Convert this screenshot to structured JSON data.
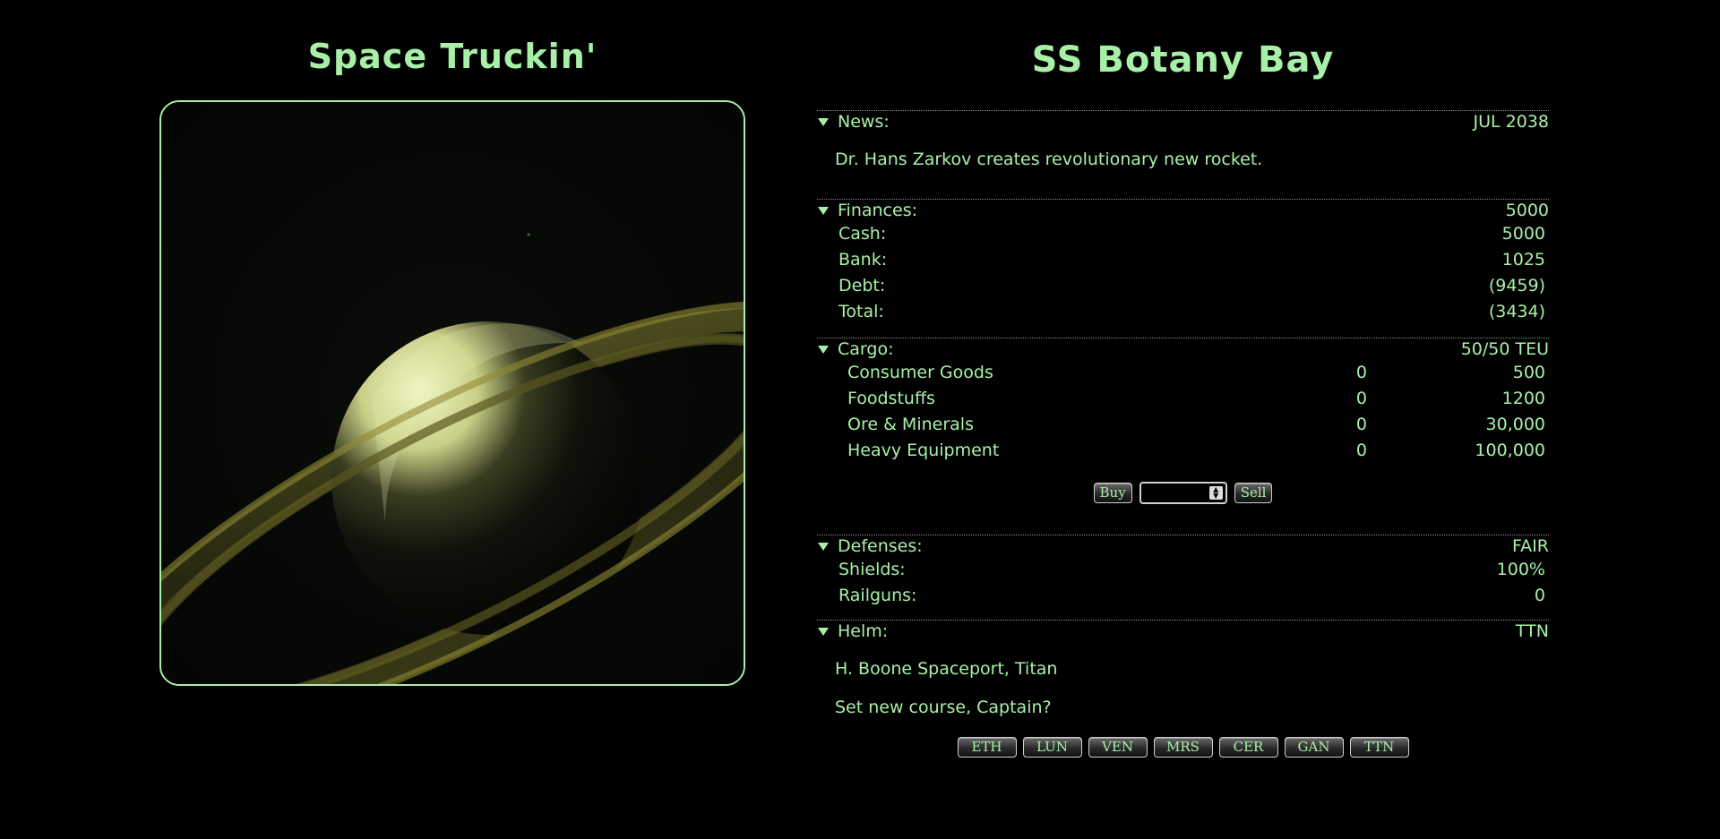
{
  "app": {
    "title": "Space Truckin'"
  },
  "ship": {
    "name": "SS Botany Bay"
  },
  "news": {
    "label": "News:",
    "date": "JUL 2038",
    "headline": "Dr. Hans Zarkov creates revolutionary new rocket."
  },
  "finances": {
    "label": "Finances:",
    "summary": "5000",
    "rows": [
      {
        "label": "Cash:",
        "value": "5000"
      },
      {
        "label": "Bank:",
        "value": "1025"
      },
      {
        "label": "Debt:",
        "value": "(9459)"
      },
      {
        "label": "Total:",
        "value": "(3434)"
      }
    ]
  },
  "cargo": {
    "label": "Cargo:",
    "capacity": "50/50 TEU",
    "items": [
      {
        "name": "Consumer Goods",
        "qty": "0",
        "price": "500"
      },
      {
        "name": "Foodstuffs",
        "qty": "0",
        "price": "1200"
      },
      {
        "name": "Ore & Minerals",
        "qty": "0",
        "price": "30,000"
      },
      {
        "name": "Heavy Equipment",
        "qty": "0",
        "price": "100,000"
      }
    ],
    "buy_label": "Buy",
    "sell_label": "Sell",
    "quantity_value": ""
  },
  "defenses": {
    "label": "Defenses:",
    "rating": "FAIR",
    "rows": [
      {
        "label": "Shields:",
        "value": "100%"
      },
      {
        "label": "Railguns:",
        "value": "0"
      }
    ]
  },
  "helm": {
    "label": "Helm:",
    "location_code": "TTN",
    "location": "H. Boone Spaceport, Titan",
    "prompt": "Set new course, Captain?",
    "destinations": [
      "ETH",
      "LUN",
      "VEN",
      "MRS",
      "CER",
      "GAN",
      "TTN"
    ]
  },
  "colors": {
    "accent": "#a8f0a8",
    "background": "#000000",
    "ring": "#8a8233",
    "planet_light": "#f0f4c0"
  },
  "scene": {
    "image": "saturn-planet-with-rings"
  }
}
